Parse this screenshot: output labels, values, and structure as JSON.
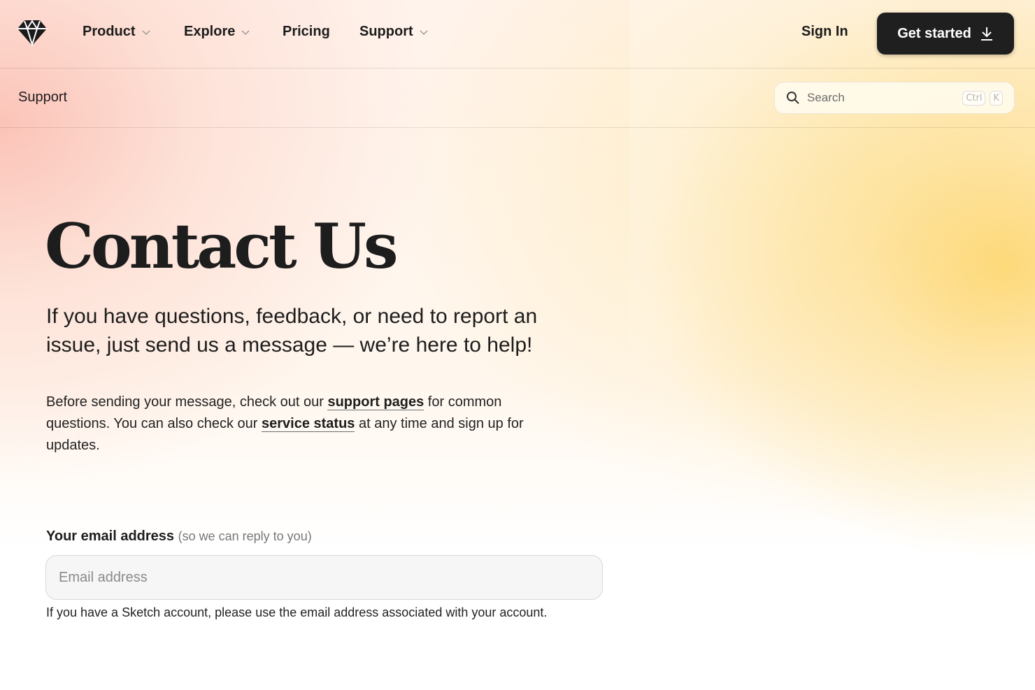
{
  "nav": {
    "items": [
      {
        "label": "Product",
        "has_dropdown": true
      },
      {
        "label": "Explore",
        "has_dropdown": true
      },
      {
        "label": "Pricing",
        "has_dropdown": false
      },
      {
        "label": "Support",
        "has_dropdown": true
      }
    ],
    "sign_in": "Sign In",
    "cta": "Get started",
    "logo_icon": "diamond-logo-icon",
    "cta_icon": "download-icon"
  },
  "subnav": {
    "title": "Support",
    "search": {
      "placeholder": "Search",
      "shortcut": [
        "Ctrl",
        "K"
      ],
      "icon": "search-icon"
    }
  },
  "hero": {
    "title": "Contact Us",
    "subtitle": "If you have questions, feedback, or need to report an issue, just send us a message — we’re here to help!",
    "body": {
      "part1": "Before sending your message, check out our ",
      "link1": "support pages",
      "part2": " for common questions. You can also check our ",
      "link2": "service status",
      "part3": " at any time and sign up for updates."
    }
  },
  "form": {
    "email_label": "Your email address",
    "email_hint": "(so we can reply to you)",
    "email_placeholder": "Email address",
    "email_value": "",
    "email_help": "If you have a Sketch account, please use the email address associated with your account."
  },
  "colors": {
    "text": "#1c1c1c",
    "cta_bg": "#1f1f1f",
    "cta_text": "#ffffff",
    "gradient_peach": "#fbbeb2",
    "gradient_yellow": "#fdd66e"
  }
}
